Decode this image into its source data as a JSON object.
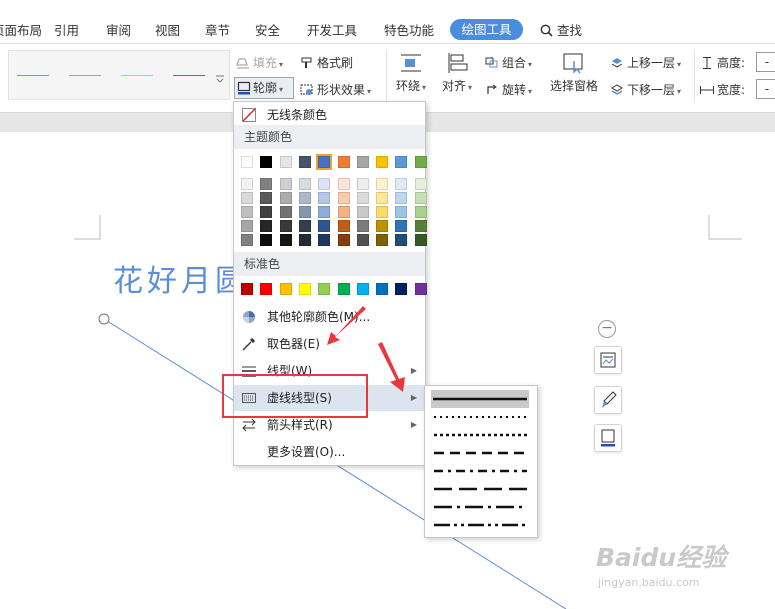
{
  "menubar": {
    "tabs": [
      "页面布局",
      "引用",
      "审阅",
      "视图",
      "章节",
      "安全",
      "开发工具",
      "特色功能"
    ],
    "active_tab": "绘图工具",
    "search": "查找"
  },
  "ribbon": {
    "fill": "填充",
    "format_painter": "格式刷",
    "outline": "轮廓",
    "shape_effects": "形状效果",
    "wrap": "环绕",
    "align": "对齐",
    "group": "组合",
    "rotate": "旋转",
    "selection_pane": "选择窗格",
    "bring_forward": "上移一层",
    "send_backward": "下移一层",
    "height": "高度:",
    "width": "宽度:",
    "height_value": "-",
    "width_value": "-",
    "gallery_colors": [
      "#ed7d31",
      "#a5a5a5",
      "#ffc000",
      "#4472c4"
    ]
  },
  "document": {
    "title_text": "花好月圆"
  },
  "dropdown": {
    "no_line_color": "无线条颜色",
    "theme_colors_heading": "主题颜色",
    "theme_row": [
      "#ffffff",
      "#000000",
      "#e7e6e6",
      "#44546a",
      "#4472c4",
      "#ed7d31",
      "#a5a5a5",
      "#ffc000",
      "#5b9bd5",
      "#70ad47"
    ],
    "theme_shades": [
      [
        "#f2f2f2",
        "#808080",
        "#d0cece",
        "#d6dce4",
        "#dae3f3",
        "#fbe5d6",
        "#ededed",
        "#fff2cc",
        "#deebf7",
        "#e2f0d9"
      ],
      [
        "#d9d9d9",
        "#595959",
        "#aeabab",
        "#adb9ca",
        "#b4c7e7",
        "#f8cbad",
        "#dbdbdb",
        "#ffe699",
        "#bdd7ee",
        "#c5e0b4"
      ],
      [
        "#bfbfbf",
        "#404040",
        "#757171",
        "#8497b0",
        "#8faadc",
        "#f4b183",
        "#c9c9c9",
        "#ffd966",
        "#9dc3e6",
        "#a9d18e"
      ],
      [
        "#a6a6a6",
        "#262626",
        "#3a3838",
        "#333f50",
        "#2f5597",
        "#c55a11",
        "#7b7b7b",
        "#bf9000",
        "#2e75b6",
        "#548235"
      ],
      [
        "#808080",
        "#0d0d0d",
        "#171616",
        "#222a35",
        "#203864",
        "#843c0c",
        "#525252",
        "#7f6000",
        "#1f4e79",
        "#385723"
      ]
    ],
    "standard_colors_heading": "标准色",
    "standard_colors": [
      "#c00000",
      "#ff0000",
      "#ffc000",
      "#ffff00",
      "#92d050",
      "#00b050",
      "#00b0f0",
      "#0070c0",
      "#002060",
      "#7030a0"
    ],
    "more_colors": "其他轮廓颜色(M)...",
    "eyedropper": "取色器(E)",
    "line_style": "线型(W)",
    "dash_style": "虚线线型(S)",
    "arrow_style": "箭头样式(R)",
    "more_settings": "更多设置(O)..."
  },
  "watermark": {
    "logo": "Baidu经验",
    "url": "jingyan.baidu.com"
  },
  "colors": {
    "accent": "#4a8dde",
    "annotation_red": "#e8383d",
    "title_blue": "#5b8ed6"
  }
}
